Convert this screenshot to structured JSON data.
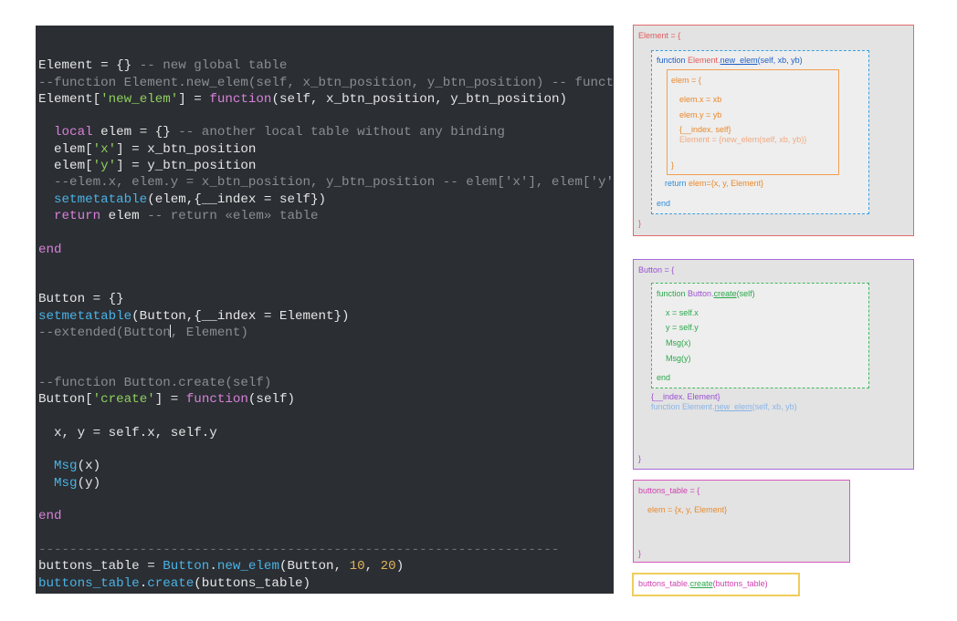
{
  "code": {
    "lines": [
      [],
      [
        {
          "t": "def",
          "s": "Element = {} "
        },
        {
          "t": "com",
          "s": "-- new global table"
        }
      ],
      [
        {
          "t": "com",
          "s": "--function Element.new_elem(self, x_btn_position, y_btn_position) -- funct"
        }
      ],
      [
        {
          "t": "def",
          "s": "Element["
        },
        {
          "t": "str",
          "s": "'new_elem'"
        },
        {
          "t": "def",
          "s": "] = "
        },
        {
          "t": "kw",
          "s": "function"
        },
        {
          "t": "def",
          "s": "(self, x_btn_position, y_btn_position)"
        }
      ],
      [],
      [
        {
          "t": "def",
          "s": "  "
        },
        {
          "t": "kw",
          "s": "local"
        },
        {
          "t": "def",
          "s": " elem = {} "
        },
        {
          "t": "com",
          "s": "-- another local table without any binding"
        }
      ],
      [
        {
          "t": "def",
          "s": "  elem["
        },
        {
          "t": "str",
          "s": "'x'"
        },
        {
          "t": "def",
          "s": "] = x_btn_position"
        }
      ],
      [
        {
          "t": "def",
          "s": "  elem["
        },
        {
          "t": "str",
          "s": "'y'"
        },
        {
          "t": "def",
          "s": "] = y_btn_position"
        }
      ],
      [
        {
          "t": "com",
          "s": "  --elem.x, elem.y = x_btn_position, y_btn_position -- elem['x'], elem['y'"
        }
      ],
      [
        {
          "t": "def",
          "s": "  "
        },
        {
          "t": "fn",
          "s": "setmetatable"
        },
        {
          "t": "def",
          "s": "(elem,{__index = self})"
        }
      ],
      [
        {
          "t": "def",
          "s": "  "
        },
        {
          "t": "kw",
          "s": "return"
        },
        {
          "t": "def",
          "s": " elem "
        },
        {
          "t": "com",
          "s": "-- return «elem» table"
        }
      ],
      [],
      [
        {
          "t": "kw",
          "s": "end"
        }
      ],
      [],
      [],
      [
        {
          "t": "def",
          "s": "Button = {}"
        }
      ],
      [
        {
          "t": "fn",
          "s": "setmetatable"
        },
        {
          "t": "def",
          "s": "(Button,{__index = Element})"
        }
      ],
      [
        {
          "t": "com",
          "s": "--extended(Button"
        },
        {
          "t": "caret",
          "s": ""
        },
        {
          "t": "com",
          "s": ", Element)"
        }
      ],
      [],
      [],
      [
        {
          "t": "com",
          "s": "--function Button.create(self)"
        }
      ],
      [
        {
          "t": "def",
          "s": "Button["
        },
        {
          "t": "str",
          "s": "'create'"
        },
        {
          "t": "def",
          "s": "] = "
        },
        {
          "t": "kw",
          "s": "function"
        },
        {
          "t": "def",
          "s": "(self)"
        }
      ],
      [],
      [
        {
          "t": "def",
          "s": "  x, y = self.x, self.y"
        }
      ],
      [],
      [
        {
          "t": "def",
          "s": "  "
        },
        {
          "t": "fn",
          "s": "Msg"
        },
        {
          "t": "def",
          "s": "(x)"
        }
      ],
      [
        {
          "t": "def",
          "s": "  "
        },
        {
          "t": "fn",
          "s": "Msg"
        },
        {
          "t": "def",
          "s": "(y)"
        }
      ],
      [],
      [
        {
          "t": "kw",
          "s": "end"
        }
      ],
      [],
      [
        {
          "t": "sep",
          "s": "-------------------------------------------------------------------"
        }
      ],
      [
        {
          "t": "def",
          "s": "buttons_table = "
        },
        {
          "t": "fn",
          "s": "Button"
        },
        {
          "t": "def",
          "s": "."
        },
        {
          "t": "fn",
          "s": "new_elem"
        },
        {
          "t": "def",
          "s": "(Button, "
        },
        {
          "t": "num",
          "s": "10"
        },
        {
          "t": "def",
          "s": ", "
        },
        {
          "t": "num",
          "s": "20"
        },
        {
          "t": "def",
          "s": ")"
        }
      ],
      [
        {
          "t": "fn",
          "s": "buttons_table"
        },
        {
          "t": "def",
          "s": "."
        },
        {
          "t": "fn",
          "s": "create"
        },
        {
          "t": "def",
          "s": "(buttons_table)"
        }
      ]
    ]
  },
  "diagram": {
    "element_box": {
      "open": "Element = {",
      "close": "}",
      "new_elem_func": {
        "kw": "function ",
        "obj": "Element",
        "dot": ".",
        "method": "new_elem",
        "args": "(self, xb, yb)"
      },
      "elem_box": {
        "open": "elem = {",
        "x_line": "elem.x = xb",
        "y_line": "elem.y = yb",
        "index_line": "{__index. self}",
        "index_expansion": "Element = {new_elem(self, xb, yb)}",
        "close": "}"
      },
      "return_kw": "return ",
      "return_value": "elem={x, y, Element}",
      "end_label": "end"
    },
    "button_box": {
      "open": "Button = {",
      "close": "}",
      "create_func": {
        "kw": "function ",
        "obj": "Button",
        "dot": ".",
        "method": "create",
        "args": "(self)"
      },
      "x_line": "x = self.x",
      "y_line": "y = self.y",
      "msg_x": "Msg(x)",
      "msg_y": "Msg(y)",
      "end_label": "end",
      "index_line": "{__index. Element}",
      "inherited_func": {
        "kw": "function ",
        "obj": "Element",
        "dot": ".",
        "method": "new_elem",
        "args": "(self, xb, yb)"
      }
    },
    "buttons_table_box": {
      "open": "buttons_table = {",
      "elem_line": "elem = {x, y, Element}",
      "close": "}"
    },
    "call_box": {
      "obj": "buttons_table",
      "dot": ".",
      "method": "create",
      "args": "(buttons_table)"
    }
  }
}
